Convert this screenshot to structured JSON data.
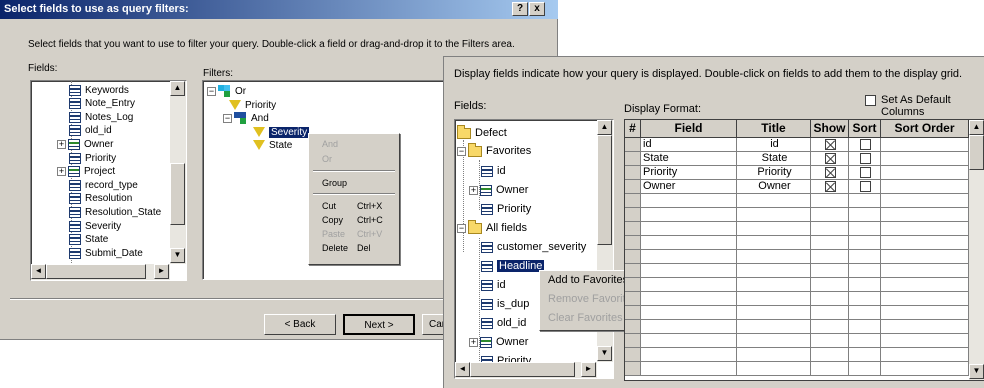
{
  "dialog1": {
    "title": "Select fields to use as query filters:",
    "help_label": "?",
    "close_label": "x",
    "instruction": "Select fields that you want to use to filter your query. Double-click a field or drag-and-drop it to the Filters area.",
    "fields_label": "Fields:",
    "filters_label": "Filters:",
    "fields": [
      "Keywords",
      "Note_Entry",
      "Notes_Log",
      "old_id",
      "Owner",
      "Priority",
      "Project",
      "record_type",
      "Resolution",
      "Resolution_State",
      "Severity",
      "State",
      "Submit_Date"
    ],
    "filters": {
      "root": "Or",
      "priority": "Priority",
      "and": "And",
      "severity": "Severity",
      "state": "State"
    },
    "context_menu": {
      "and": "And",
      "or": "Or",
      "group": "Group",
      "cut": "Cut",
      "cut_shortcut": "Ctrl+X",
      "copy": "Copy",
      "copy_shortcut": "Ctrl+C",
      "paste": "Paste",
      "paste_shortcut": "Ctrl+V",
      "delete": "Delete",
      "delete_shortcut": "Del"
    },
    "back_button": "< Back",
    "next_button": "Next >",
    "cancel_button": "Canc"
  },
  "dialog2": {
    "instruction": "Display fields indicate how your query is displayed. Double-click on fields to add them to the display grid.",
    "fields_label": "Fields:",
    "display_format_label": "Display Format:",
    "default_columns_label": "Set As Default Columns",
    "tree": {
      "defect": "Defect",
      "favorites": "Favorites",
      "fav_items": [
        "id",
        "Owner",
        "Priority"
      ],
      "all_fields": "All fields",
      "all_items": [
        "customer_severity",
        "Headline",
        "id",
        "is_dup",
        "old_id",
        "Owner",
        "Priority"
      ]
    },
    "context_menu": {
      "add": "Add to Favorites",
      "remove": "Remove Favorites",
      "clear": "Clear Favorites"
    },
    "grid": {
      "headers": [
        "#",
        "Field",
        "Title",
        "Show",
        "Sort",
        "Sort Order"
      ],
      "rows": [
        {
          "field": "id",
          "title": "id",
          "show": true,
          "sort": false
        },
        {
          "field": "State",
          "title": "State",
          "show": true,
          "sort": false
        },
        {
          "field": "Priority",
          "title": "Priority",
          "show": true,
          "sort": false
        },
        {
          "field": "Owner",
          "title": "Owner",
          "show": true,
          "sort": false
        }
      ]
    }
  }
}
